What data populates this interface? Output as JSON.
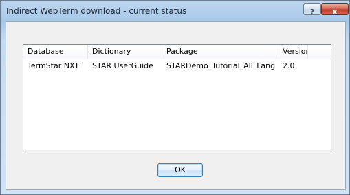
{
  "window": {
    "title": "Indirect WebTerm download - current status",
    "help_glyph": "?",
    "close_glyph": "x"
  },
  "list": {
    "columns": [
      "Database",
      "Dictionary",
      "Package",
      "Version"
    ],
    "rows": [
      [
        "TermStar NXT",
        "STAR UserGuide",
        "STARDemo_Tutorial_All_Lang",
        "2.0"
      ]
    ]
  },
  "buttons": {
    "ok_label": "OK"
  }
}
